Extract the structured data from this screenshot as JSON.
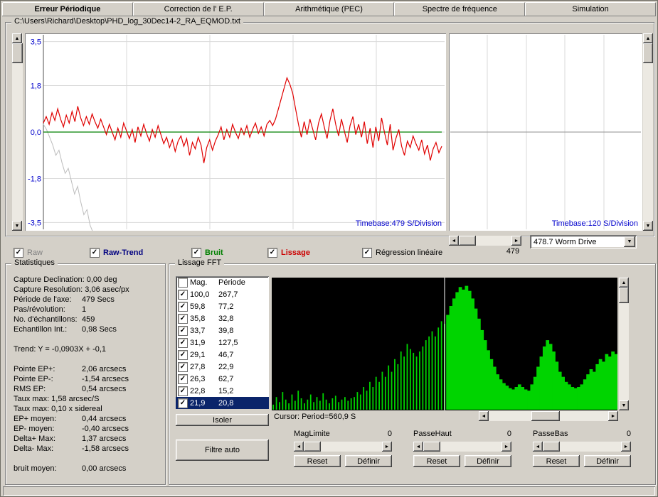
{
  "tabs": [
    {
      "label": "Erreur Périodique",
      "active": true
    },
    {
      "label": "Correction de l' E.P."
    },
    {
      "label": "Arithmétique (PEC)"
    },
    {
      "label": "Spectre de fréquence"
    },
    {
      "label": "Simulation"
    }
  ],
  "file_group": {
    "title": "C:\\Users\\Richard\\Desktop\\PHD_log_30Dec14-2_RA_EQMOD.txt"
  },
  "scroll_value": "479",
  "worm_combo": {
    "value": "478.7 Worm Drive"
  },
  "checkboxes": [
    {
      "label": "Raw",
      "checked": true,
      "color": "#808080",
      "bold": false
    },
    {
      "label": "Raw-Trend",
      "checked": true,
      "color": "#000080",
      "bold": true
    },
    {
      "label": "Bruit",
      "checked": true,
      "color": "#008000",
      "bold": true
    },
    {
      "label": "Lissage",
      "checked": true,
      "color": "#cc0000",
      "bold": true
    },
    {
      "label": "Régression linéaire",
      "checked": true,
      "color": "#000000",
      "bold": false
    }
  ],
  "stats": {
    "title": "Statistiques",
    "lines": [
      {
        "label": "Capture Declination:",
        "value": "0,00 deg",
        "col": false
      },
      {
        "label": "Capture Resolution:",
        "value": "3,06 asec/px",
        "col": false
      },
      {
        "label": "Période de l'axe:",
        "value": "479 Secs",
        "col": true
      },
      {
        "label": "Pas/révolution:",
        "value": "1",
        "col": true
      },
      {
        "label": "No. d'échantillons:",
        "value": "459",
        "col": true
      },
      {
        "label": "Echantillon Int.:",
        "value": "0,98 Secs",
        "col": true
      },
      {
        "blank": true
      },
      {
        "label": "Trend: Y = -0,0903X + -0,1",
        "value": "",
        "col": false
      },
      {
        "blank": true
      },
      {
        "label": "Pointe EP+:",
        "value": "2,06 arcsecs",
        "col": true
      },
      {
        "label": "Pointe EP-:",
        "value": "-1,54 arcsecs",
        "col": true
      },
      {
        "label": "RMS EP:",
        "value": "0,54 arcsecs",
        "col": true
      },
      {
        "label": "Taux max: 1,58 arcsec/S",
        "value": "",
        "col": false
      },
      {
        "label": "Taux max: 0,10 x sidereal",
        "value": "",
        "col": false
      },
      {
        "label": "EP+ moyen:",
        "value": "0,44 arcsecs",
        "col": true
      },
      {
        "label": "EP- moyen:",
        "value": "-0,40 arcsecs",
        "col": true
      },
      {
        "label": "Delta+ Max:",
        "value": "1,37 arcsecs",
        "col": true
      },
      {
        "label": "Delta- Max:",
        "value": "-1,58 arcsecs",
        "col": true
      },
      {
        "blank": true
      },
      {
        "label": "bruit moyen:",
        "value": "0,00 arcsecs",
        "col": true
      }
    ]
  },
  "fft": {
    "title": "Lissage FFT",
    "list_header": {
      "mag": "Mag.",
      "period": "Période"
    },
    "rows": [
      {
        "mag": "100,0",
        "period": "267,7",
        "checked": true
      },
      {
        "mag": "59,8",
        "period": "77,2",
        "checked": true
      },
      {
        "mag": "35,8",
        "period": "32,8",
        "checked": true
      },
      {
        "mag": "33,7",
        "period": "39,8",
        "checked": true
      },
      {
        "mag": "31,9",
        "period": "127,5",
        "checked": true
      },
      {
        "mag": "29,1",
        "period": "46,7",
        "checked": true
      },
      {
        "mag": "27,8",
        "period": "22,9",
        "checked": true
      },
      {
        "mag": "26,3",
        "period": "62,7",
        "checked": true
      },
      {
        "mag": "22,8",
        "period": "15,2",
        "checked": true
      },
      {
        "mag": "21,9",
        "period": "20,8",
        "checked": true,
        "selected": true
      }
    ],
    "cursor_label": "Cursor: Period=560,9 S",
    "isoler_label": "Isoler",
    "filtre_label": "Filtre auto",
    "sliders": [
      {
        "label": "MagLimite",
        "value": "0",
        "reset_label": "Reset",
        "definir_label": "Définir"
      },
      {
        "label": "PasseHaut",
        "value": "0",
        "reset_label": "Reset",
        "definir_label": "Définir"
      },
      {
        "label": "PasseBas",
        "value": "0",
        "reset_label": "Reset",
        "definir_label": "Définir"
      }
    ]
  },
  "chart_data": {
    "main": {
      "type": "line",
      "ylim": [
        -3.5,
        3.5
      ],
      "y_ticks": [
        3.5,
        1.8,
        0.0,
        -1.8,
        -3.5
      ],
      "y_tick_labels": [
        "3,5",
        "1,8",
        "0,0",
        "-1,8",
        "-3,5"
      ],
      "timebase_label": "Timebase:479 S/Division",
      "axis_color": "#0000cc",
      "series": [
        {
          "name": "lissage",
          "color": "#e00000",
          "values": [
            0.35,
            0.6,
            0.3,
            0.75,
            0.45,
            0.9,
            0.5,
            0.2,
            0.65,
            0.35,
            0.8,
            0.4,
            1.0,
            0.55,
            0.25,
            0.6,
            0.3,
            0.7,
            0.4,
            0.15,
            0.5,
            0.2,
            -0.1,
            0.3,
            0.0,
            -0.3,
            0.15,
            -0.2,
            0.35,
            0.05,
            -0.25,
            0.1,
            -0.4,
            0.2,
            -0.15,
            0.3,
            -0.05,
            -0.35,
            0.1,
            -0.2,
            0.25,
            -0.1,
            -0.45,
            -0.2,
            -0.6,
            -0.3,
            -0.75,
            -0.35,
            -0.15,
            -0.55,
            -0.25,
            -0.9,
            -0.4,
            -0.65,
            -0.2,
            -0.5,
            -1.2,
            -0.6,
            -0.3,
            -0.7,
            -0.35,
            -0.1,
            0.2,
            -0.3,
            0.1,
            -0.2,
            0.3,
            0.0,
            -0.25,
            0.15,
            -0.1,
            0.25,
            -0.2,
            0.1,
            0.35,
            -0.05,
            0.2,
            -0.15,
            0.3,
            0.45,
            0.25,
            0.5,
            0.9,
            1.3,
            1.7,
            2.1,
            1.85,
            1.5,
            0.9,
            0.3,
            -0.2,
            0.4,
            -0.1,
            0.5,
            0.1,
            -0.3,
            0.35,
            0.7,
            0.2,
            -0.25,
            0.45,
            0.9,
            0.3,
            -0.15,
            0.5,
            0.05,
            -0.4,
            0.25,
            0.6,
            -0.1,
            0.3,
            -0.2,
            0.4,
            -0.45,
            0.15,
            -0.6,
            0.2,
            -0.35,
            0.55,
            0.0,
            -0.5,
            0.3,
            -0.7,
            -0.25,
            0.1,
            -0.55,
            -0.9,
            -0.35,
            -0.6,
            -0.15,
            -0.45,
            -0.7,
            -0.3,
            -0.85,
            -0.5,
            -1.1,
            -0.65,
            -0.4,
            -0.8,
            -0.55
          ]
        },
        {
          "name": "raw-drift",
          "color": "#bdbdbd",
          "values": [
            0.3,
            0.1,
            -0.2,
            -0.5,
            -0.9,
            -0.7,
            -1.2,
            -1.6,
            -1.4,
            -1.9,
            -2.4,
            -2.1,
            -2.7,
            -3.2,
            -3.0,
            -3.6,
            -3.9
          ]
        },
        {
          "name": "bruit",
          "color": "#008000",
          "flat": 0
        }
      ]
    },
    "right": {
      "timebase_label": "Timebase:120 S/Division"
    },
    "fft_plot": {
      "type": "bar",
      "color": "#00d400",
      "cursor_fraction": 0.5,
      "values": [
        0.04,
        0.1,
        0.06,
        0.14,
        0.08,
        0.05,
        0.12,
        0.07,
        0.15,
        0.09,
        0.05,
        0.08,
        0.12,
        0.06,
        0.1,
        0.07,
        0.13,
        0.08,
        0.05,
        0.09,
        0.11,
        0.06,
        0.08,
        0.1,
        0.07,
        0.09,
        0.1,
        0.14,
        0.12,
        0.18,
        0.15,
        0.22,
        0.18,
        0.26,
        0.22,
        0.3,
        0.26,
        0.35,
        0.3,
        0.4,
        0.36,
        0.46,
        0.42,
        0.52,
        0.48,
        0.45,
        0.42,
        0.46,
        0.5,
        0.55,
        0.58,
        0.62,
        0.58,
        0.65,
        0.7,
        0.68,
        0.75,
        0.82,
        0.88,
        0.93,
        0.97,
        0.95,
        0.98,
        0.94,
        0.88,
        0.8,
        0.72,
        0.63,
        0.55,
        0.47,
        0.4,
        0.34,
        0.28,
        0.24,
        0.21,
        0.19,
        0.17,
        0.16,
        0.18,
        0.2,
        0.18,
        0.16,
        0.15,
        0.2,
        0.26,
        0.34,
        0.42,
        0.5,
        0.55,
        0.52,
        0.46,
        0.38,
        0.3,
        0.26,
        0.22,
        0.2,
        0.18,
        0.17,
        0.18,
        0.2,
        0.24,
        0.28,
        0.32,
        0.3,
        0.36,
        0.4,
        0.38,
        0.44,
        0.42,
        0.46,
        0.44
      ]
    }
  }
}
